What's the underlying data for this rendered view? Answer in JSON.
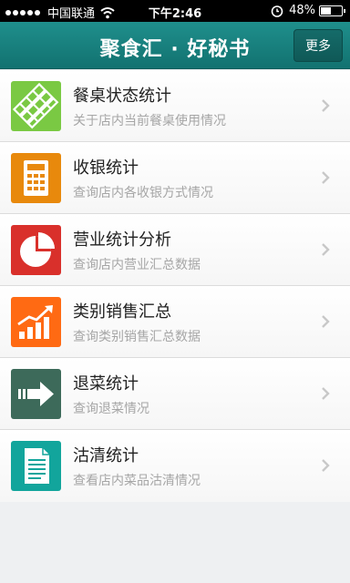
{
  "status_bar": {
    "carrier": "中国联通",
    "time": "下午2:46",
    "battery": "48%",
    "battery_level": 0.48
  },
  "header": {
    "title": "聚食汇 · 好秘书",
    "more_label": "更多"
  },
  "menu": [
    {
      "title": "餐桌状态统计",
      "subtitle": "关于店内当前餐桌使用情况",
      "icon": "table-status-icon",
      "color": "#7ac943"
    },
    {
      "title": "收银统计",
      "subtitle": "查询店内各收银方式情况",
      "icon": "calculator-icon",
      "color": "#e8890c"
    },
    {
      "title": "营业统计分析",
      "subtitle": "查询店内营业汇总数据",
      "icon": "pie-chart-icon",
      "color": "#d9302b"
    },
    {
      "title": "类别销售汇总",
      "subtitle": "查询类别销售汇总数据",
      "icon": "growth-chart-icon",
      "color": "#ff6a13"
    },
    {
      "title": "退菜统计",
      "subtitle": "查询退菜情况",
      "icon": "return-arrow-icon",
      "color": "#3d6a5a"
    },
    {
      "title": "沽清统计",
      "subtitle": "查看店内菜品沽清情况",
      "icon": "document-icon",
      "color": "#12a59c"
    }
  ]
}
